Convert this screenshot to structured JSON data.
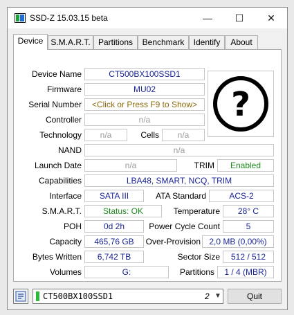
{
  "window": {
    "title": "SSD-Z 15.03.15 beta",
    "minimize_glyph": "—",
    "maximize_glyph": "☐",
    "close_glyph": "✕"
  },
  "tabs": [
    "Device",
    "S.M.A.R.T.",
    "Partitions",
    "Benchmark",
    "Identify",
    "About"
  ],
  "active_tab": "Device",
  "device": {
    "device_name_label": "Device Name",
    "device_name": "CT500BX100SSD1",
    "firmware_label": "Firmware",
    "firmware": "MU02",
    "serial_label": "Serial Number",
    "serial": "<Click or Press F9 to Show>",
    "controller_label": "Controller",
    "controller": "n/a",
    "technology_label": "Technology",
    "technology": "n/a",
    "cells_label": "Cells",
    "cells": "n/a",
    "nand_label": "NAND",
    "nand": "n/a",
    "launch_date_label": "Launch Date",
    "launch_date": "n/a",
    "trim_label": "TRIM",
    "trim": "Enabled",
    "capabilities_label": "Capabilities",
    "capabilities": "LBA48, SMART, NCQ, TRIM",
    "interface_label": "Interface",
    "interface": "SATA III",
    "ata_standard_label": "ATA Standard",
    "ata_standard": "ACS-2",
    "smart_label": "S.M.A.R.T.",
    "smart_status": "Status: OK",
    "temperature_label": "Temperature",
    "temperature": "28° C",
    "poh_label": "POH",
    "poh": "0d 2h",
    "power_cycle_label": "Power Cycle Count",
    "power_cycle": "5",
    "capacity_label": "Capacity",
    "capacity": "465,76 GB",
    "over_provision_label": "Over-Provision",
    "over_provision": "2,0 MB (0,00%)",
    "bytes_written_label": "Bytes Written",
    "bytes_written": "6,742 TB",
    "sector_size_label": "Sector Size",
    "sector_size": "512 / 512",
    "volumes_label": "Volumes",
    "volumes": "G:",
    "partitions_label": "Partitions",
    "partitions": "1 / 4 (MBR)",
    "help_glyph": "?"
  },
  "bottom": {
    "drive_name": "CT500BX100SSD1",
    "drive_number": "2",
    "quit_label": "Quit"
  },
  "colors": {
    "value_blue": "#1a2596",
    "value_grey": "#9a9a9a",
    "value_green": "#1c8a1c",
    "drive_green": "#2dbb3f"
  }
}
